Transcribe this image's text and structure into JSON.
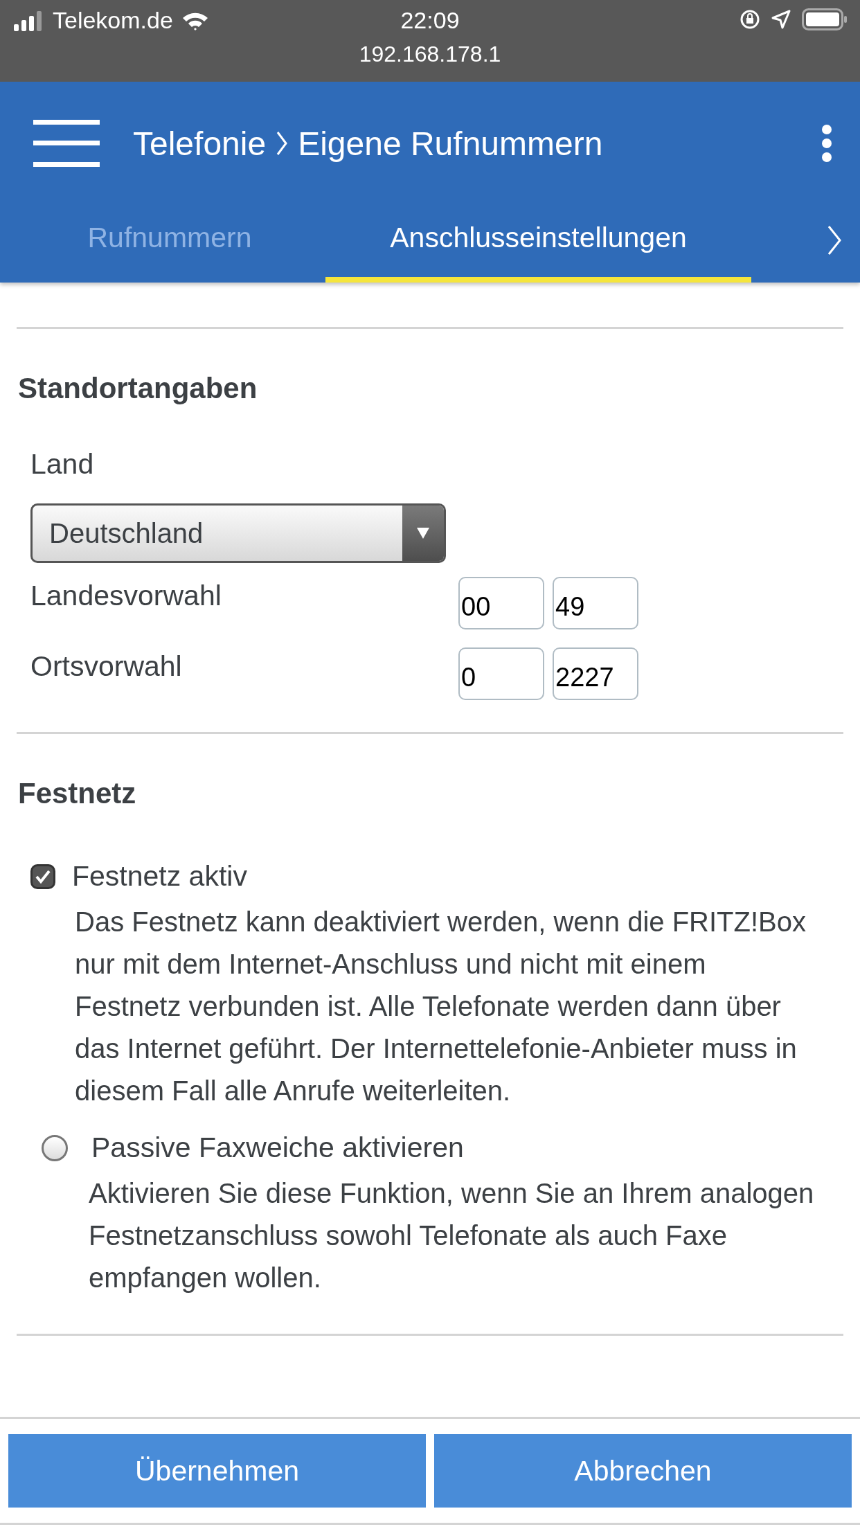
{
  "status_bar": {
    "carrier": "Telekom.de",
    "time": "22:09",
    "url": "192.168.178.1"
  },
  "header": {
    "breadcrumb": [
      {
        "label": "Telefonie"
      },
      {
        "label": "Eigene Rufnummern"
      }
    ]
  },
  "tabs": [
    {
      "label": "Rufnummern",
      "selected": false
    },
    {
      "label": "Anschlusseinstellungen",
      "selected": true
    }
  ],
  "location": {
    "title": "Standortangaben",
    "country_label": "Land",
    "country": "Deutschland",
    "rows": [
      {
        "label": "Landesvorwahl",
        "values": [
          "00",
          "49"
        ]
      },
      {
        "label": "Ortsvorwahl",
        "values": [
          "0",
          "2227"
        ]
      }
    ]
  },
  "landline": {
    "title": "Festnetz",
    "options": [
      {
        "label": "Festnetz aktiv",
        "checked": true,
        "description": "Das Festnetz kann deaktiviert werden, wenn die FRITZ!Box nur mit dem Internet-Anschluss und nicht mit einem Festnetz verbunden ist. Alle Telefonate werden dann über das Internet geführt. Der Internettelefonie-Anbieter muss in diesem Fall alle Anrufe weiterleiten."
      },
      {
        "label": "Passive Faxweiche aktivieren",
        "checked": false,
        "description": "Aktivieren Sie diese Funktion, wenn Sie an Ihrem analogen Festnetzanschluss sowohl Telefonate als auch Faxe empfangen wollen."
      }
    ]
  },
  "buttons": [
    {
      "label": "Übernehmen"
    },
    {
      "label": "Abbrechen"
    }
  ]
}
